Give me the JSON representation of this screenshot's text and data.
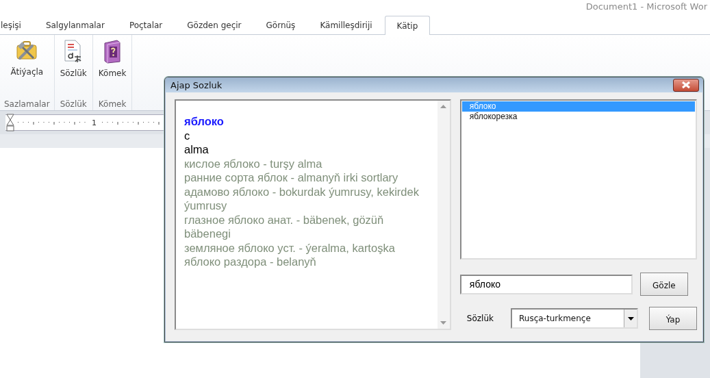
{
  "app_title": "Document1 - Microsoft Wor",
  "ribbon_tabs": [
    {
      "label": "leşişi",
      "selected": false
    },
    {
      "label": "Salgylanmalar",
      "selected": false
    },
    {
      "label": "Poçtalar",
      "selected": false
    },
    {
      "label": "Gözden geçir",
      "selected": false
    },
    {
      "label": "Görnüş",
      "selected": false
    },
    {
      "label": "Kämilleşdiriji",
      "selected": false
    },
    {
      "label": "Kätip",
      "selected": true
    }
  ],
  "ribbon_groups": [
    {
      "label": "Sazlamalar",
      "button": {
        "label": "Ätiýaçla",
        "kind": "tools"
      }
    },
    {
      "label": "Sözlük",
      "button": {
        "label": "Sözlük",
        "kind": "dictionary"
      }
    },
    {
      "label": "Kömek",
      "button": {
        "label": "Kömek",
        "kind": "help"
      }
    }
  ],
  "ruler": {
    "label": "1"
  },
  "dialog": {
    "title": "Ajap Sozluk",
    "entry": [
      {
        "kind": "headword",
        "text": "яблоко"
      },
      {
        "kind": "grammar",
        "text": "с"
      },
      {
        "kind": "translation",
        "text": "alma"
      },
      {
        "kind": "phrase",
        "text": "кислое яблоко - turşy alma"
      },
      {
        "kind": "phrase",
        "text": "ранние сорта яблок - almanyň irki sortlary"
      },
      {
        "kind": "phrase",
        "text": "адамово яблоко - bokurdak ýumrusy, kekirdek ýumrusy"
      },
      {
        "kind": "phrase",
        "text": "глазное яблоко анат. - bäbenek, gözüň bäbenegi"
      },
      {
        "kind": "phrase",
        "text": "земляное яблоко уст. - ýeralma, kartoşka"
      },
      {
        "kind": "phrase",
        "text": "яблоко раздора - belanyň"
      }
    ],
    "word_list": [
      {
        "text": "яблоко",
        "selected": true
      },
      {
        "text": "яблокорезка",
        "selected": false
      }
    ],
    "search": {
      "value": "яблоко"
    },
    "search_button": "Gözle",
    "dictionary_label": "Sözlük",
    "dictionary": {
      "value": "Rusça-turkmençe"
    },
    "apply_button": "Ýap"
  }
}
